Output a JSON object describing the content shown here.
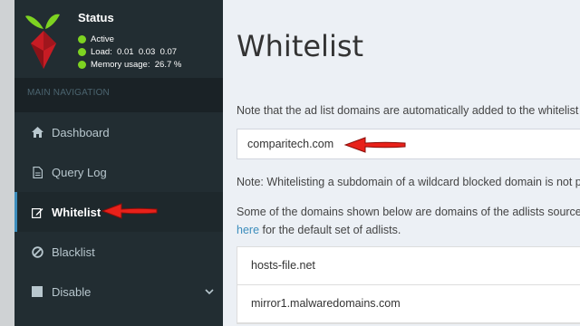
{
  "status": {
    "title": "Status",
    "items": [
      {
        "label": "Active"
      },
      {
        "label": "Load:  0.01  0.03  0.07"
      },
      {
        "label": "Memory usage:  26.7 %"
      }
    ],
    "dot_color": "#7ed321"
  },
  "nav": {
    "header": "MAIN NAVIGATION",
    "items": [
      {
        "label": "Dashboard",
        "icon": "home-icon"
      },
      {
        "label": "Query Log",
        "icon": "file-icon"
      },
      {
        "label": "Whitelist",
        "icon": "edit-icon",
        "active": true
      },
      {
        "label": "Blacklist",
        "icon": "ban-icon"
      },
      {
        "label": "Disable",
        "icon": "stop-icon"
      }
    ]
  },
  "main": {
    "title": "Whitelist",
    "note_auto": "Note that the ad list domains are automatically added to the whitelist",
    "input_value": "comparitech.com",
    "note_wildcard": "Note: Whitelisting a subdomain of a wildcard blocked domain is not possible.",
    "note_adlists_line1": "Some of the domains shown below are domains of the adlists sources",
    "note_adlists_link": "here",
    "note_adlists_line2": " for the default set of adlists.",
    "domains": [
      "hosts-file.net",
      "mirror1.malwaredomains.com"
    ]
  },
  "colors": {
    "sidebar_bg": "#222d32",
    "accent": "#3c8dbc",
    "annotation_arrow": "#e8211a"
  }
}
